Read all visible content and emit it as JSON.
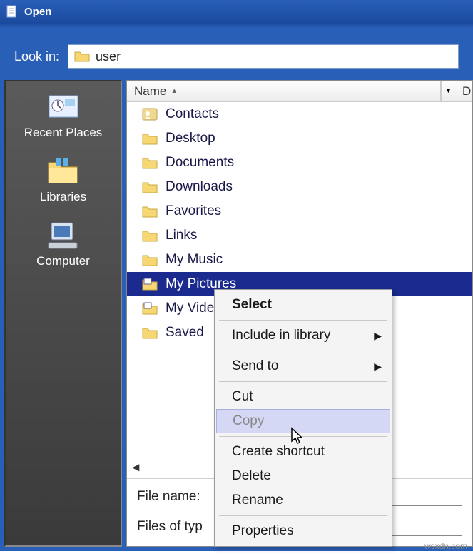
{
  "titlebar": {
    "title": "Open"
  },
  "toolbar": {
    "lookin_label": "Look in:",
    "current_folder": "user"
  },
  "places": {
    "recent": "Recent Places",
    "libraries": "Libraries",
    "computer": "Computer"
  },
  "columns": {
    "name": "Name",
    "date_initial": "D"
  },
  "files": [
    {
      "icon": "contacts",
      "label": "Contacts"
    },
    {
      "icon": "folder",
      "label": "Desktop"
    },
    {
      "icon": "folder",
      "label": "Documents"
    },
    {
      "icon": "folder",
      "label": "Downloads"
    },
    {
      "icon": "folder",
      "label": "Favorites"
    },
    {
      "icon": "folder",
      "label": "Links"
    },
    {
      "icon": "folder",
      "label": "My Music"
    },
    {
      "icon": "folder-special",
      "label": "My Pictures",
      "selected": true
    },
    {
      "icon": "folder-special",
      "label": "My Videos"
    },
    {
      "icon": "folder",
      "label": "Saved"
    }
  ],
  "bottom": {
    "filename_label": "File name:",
    "filetype_label": "Files of typ"
  },
  "context_menu": {
    "select": "Select",
    "include": "Include in library",
    "sendto": "Send to",
    "cut": "Cut",
    "copy": "Copy",
    "create_shortcut": "Create shortcut",
    "delete": "Delete",
    "rename": "Rename",
    "properties": "Properties"
  },
  "watermark": "wsxdn.com"
}
